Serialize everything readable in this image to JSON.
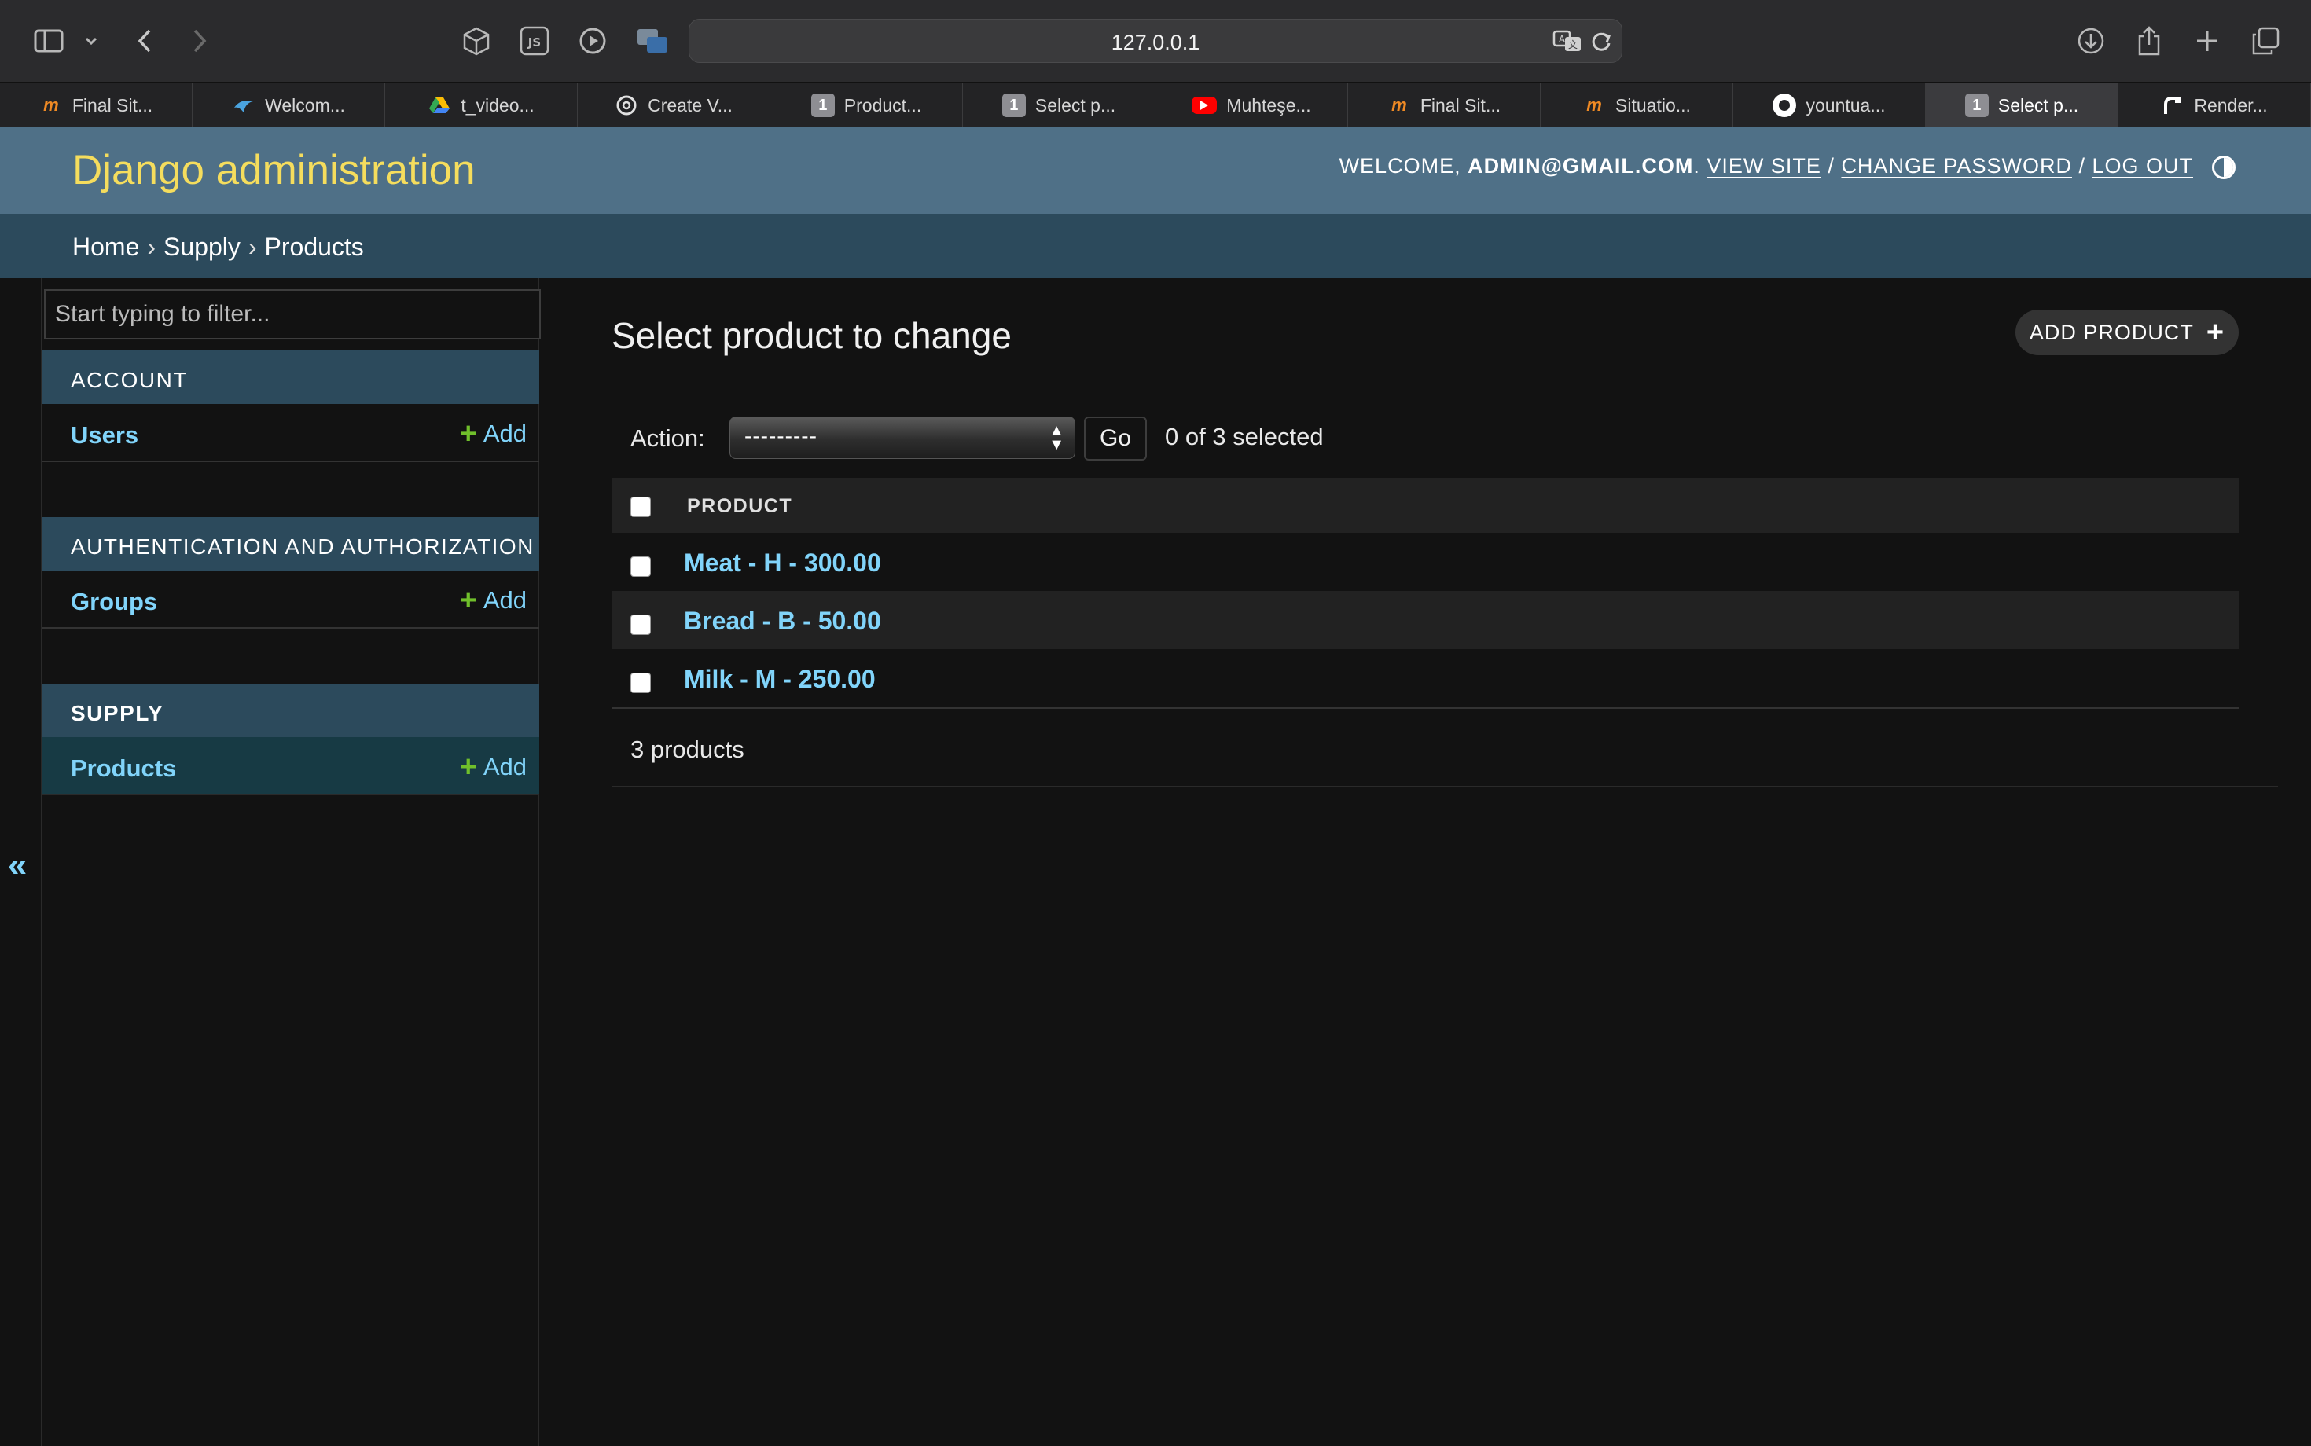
{
  "browser": {
    "url": "127.0.0.1",
    "tabs": [
      {
        "label": "Final Sit...",
        "icon": "mot-icon"
      },
      {
        "label": "Welcom...",
        "icon": "bird-icon"
      },
      {
        "label": "t_video...",
        "icon": "drive-icon"
      },
      {
        "label": "Create V...",
        "icon": "openai-icon"
      },
      {
        "label": "Product...",
        "icon": "number-1-icon"
      },
      {
        "label": "Select p...",
        "icon": "number-1-icon"
      },
      {
        "label": "Muhteşe...",
        "icon": "youtube-icon"
      },
      {
        "label": "Final Sit...",
        "icon": "mot-icon"
      },
      {
        "label": "Situatio...",
        "icon": "mot-icon"
      },
      {
        "label": "yountua...",
        "icon": "github-icon"
      },
      {
        "label": "Select p...",
        "icon": "number-1-icon"
      },
      {
        "label": "Render...",
        "icon": "render-icon"
      }
    ],
    "favicon_num": "1",
    "favicon_mot": "m"
  },
  "header": {
    "branding": "Django administration",
    "welcome": "WELCOME, ",
    "user": "ADMIN@GMAIL.COM",
    "dot": ". ",
    "view_site": "VIEW SITE",
    "slash": " / ",
    "change_password": "CHANGE PASSWORD",
    "log_out": "LOG OUT"
  },
  "breadcrumbs": {
    "home": "Home",
    "sep": "›",
    "supply": "Supply",
    "products": "Products"
  },
  "sidebar": {
    "filter_placeholder": "Start typing to filter...",
    "modules": [
      {
        "caption": "ACCOUNT",
        "models": [
          {
            "name": "Users",
            "add": "Add"
          }
        ]
      },
      {
        "caption": "AUTHENTICATION AND AUTHORIZATION",
        "models": [
          {
            "name": "Groups",
            "add": "Add"
          }
        ]
      },
      {
        "caption": "SUPPLY",
        "models": [
          {
            "name": "Products",
            "add": "Add"
          }
        ]
      }
    ],
    "collapse": "«"
  },
  "content": {
    "title": "Select product to change",
    "add_button": "ADD PRODUCT",
    "action_label": "Action:",
    "action_selected": "---------",
    "go": "Go",
    "counter": "0 of 3 selected",
    "column_header": "PRODUCT",
    "rows": [
      "Meat - H - 300.00",
      "Bread - B - 50.00",
      "Milk - M - 250.00"
    ],
    "paginator": "3 products"
  },
  "colors": {
    "header_bg": "#4f7087",
    "branding": "#f5dd5d",
    "breadcrumbs_bg": "#2c4a5c",
    "link": "#81d4fa",
    "add_plus": "#70bf2b",
    "body_bg": "#121212"
  }
}
